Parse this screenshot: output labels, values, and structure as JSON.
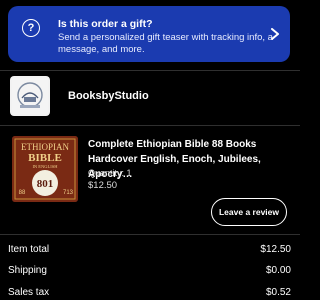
{
  "gift_banner": {
    "icon": "question-icon",
    "title": "Is this order a gift?",
    "description": "Send a personalized gift teaser with tracking info, a message, and more.",
    "chevron": "chevron-right-icon",
    "color": "#1b3bb0"
  },
  "shop": {
    "name": "BooksbyStudio",
    "avatar_icon": "shop-logo"
  },
  "listing": {
    "title": "Complete Ethiopian Bible 88 Books Hardcover English, Enoch, Jubilees, Apocry…",
    "quantity": "Quantity: 1",
    "price": "$12.50",
    "thumb": {
      "line1": "ETHIOPIAN",
      "line2": "BIBLE",
      "line3": "IN ENGLISH",
      "number": "801",
      "left_badge": "88",
      "right_badge": "713"
    }
  },
  "actions": {
    "review_label": "Leave a review"
  },
  "summary": [
    {
      "label": "Item total",
      "value": "$12.50"
    },
    {
      "label": "Shipping",
      "value": "$0.00"
    },
    {
      "label": "Sales tax",
      "value": "$0.52"
    }
  ]
}
